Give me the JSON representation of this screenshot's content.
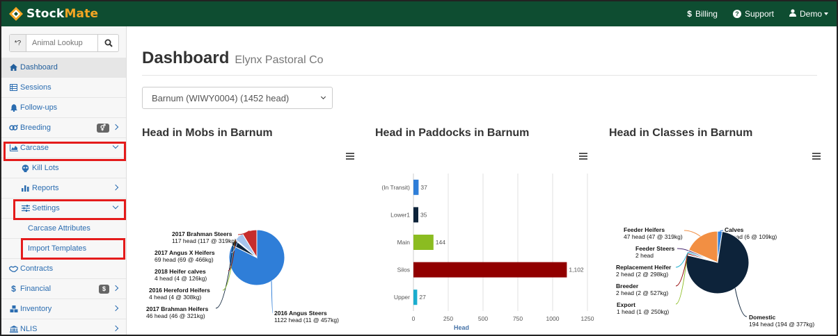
{
  "brand": {
    "name_a": "Stock",
    "name_b": "Mate"
  },
  "topnav": {
    "billing": "Billing",
    "billing_icon": "$",
    "support": "Support",
    "user": "Demo"
  },
  "search": {
    "prefix": "*?",
    "placeholder": "Animal Lookup"
  },
  "sidebar": {
    "items": [
      {
        "label": "Dashboard",
        "icon": "home-icon"
      },
      {
        "label": "Sessions",
        "icon": "table-icon"
      },
      {
        "label": "Follow-ups",
        "icon": "bell-icon"
      },
      {
        "label": "Breeding",
        "icon": "gender-icon"
      },
      {
        "label": "Carcase",
        "icon": "area-chart-icon"
      },
      {
        "label": "Kill Lots",
        "icon": "skull-icon"
      },
      {
        "label": "Reports",
        "icon": "bar-chart-icon"
      },
      {
        "label": "Settings",
        "icon": "sliders-icon"
      },
      {
        "label": "Carcase Attributes"
      },
      {
        "label": "Import Templates"
      },
      {
        "label": "Contracts",
        "icon": "handshake-icon"
      },
      {
        "label": "Financial",
        "icon": "dollar-icon",
        "badge": "$"
      },
      {
        "label": "Inventory",
        "icon": "cubes-icon"
      },
      {
        "label": "NLIS",
        "icon": "bank-icon"
      }
    ]
  },
  "page": {
    "title": "Dashboard",
    "subtitle": "Elynx Pastoral Co",
    "property_select": "Barnum (WIWY0004) (1452 head)"
  },
  "chart_data": [
    {
      "type": "pie",
      "title": "Head in Mobs in Barnum",
      "slices": [
        {
          "name": "2016 Angus Steers",
          "detail": "1122 head (11 @ 457kg)",
          "value": 1122,
          "color": "#2f7ed8"
        },
        {
          "name": "2017 Brahman Heifers",
          "detail": "46 head (46 @ 321kg)",
          "value": 46,
          "color": "#0d233a"
        },
        {
          "name": "2016 Hereford Heifers",
          "detail": "4 head (4 @ 308kg)",
          "value": 4,
          "color": "#8bbc21"
        },
        {
          "name": "2018 Heifer calves",
          "detail": "4 head (4 @ 126kg)",
          "value": 4,
          "color": "#910000"
        },
        {
          "name": "2017 Angus X Heifers",
          "detail": "69 head (69 @ 466kg)",
          "value": 69,
          "color": "#a6c5ee"
        },
        {
          "name": "2017 Brahman Steers",
          "detail": "117 head (117 @ 319kg)",
          "value": 117,
          "color": "#c62d2d"
        }
      ]
    },
    {
      "type": "bar",
      "title": "Head in Paddocks in Barnum",
      "categories": [
        "(In Transit)",
        "Lower1",
        "Main",
        "Silos",
        "Upper"
      ],
      "values": [
        37,
        35,
        144,
        1102,
        27
      ],
      "value_labels": [
        "37",
        "35",
        "144",
        "1,102",
        "27"
      ],
      "colors": [
        "#2f7ed8",
        "#0d233a",
        "#8bbc21",
        "#910000",
        "#1aadce"
      ],
      "xlabel": "Head",
      "xlim": [
        0,
        1250
      ],
      "ticks": [
        "0",
        "250",
        "500",
        "750",
        "1000",
        "1250"
      ]
    },
    {
      "type": "pie",
      "title": "Head in Classes in Barnum",
      "slices": [
        {
          "name": "Calves",
          "detail": "6 head (6 @ 109kg)",
          "value": 6,
          "color": "#2f7ed8"
        },
        {
          "name": "Domestic",
          "detail": "194 head (194 @ 377kg)",
          "value": 194,
          "color": "#0d233a"
        },
        {
          "name": "Export",
          "detail": "1 head (1 @ 250kg)",
          "value": 1,
          "color": "#8bbc21"
        },
        {
          "name": "Breeder",
          "detail": "2 head (2 @ 527kg)",
          "value": 2,
          "color": "#910000"
        },
        {
          "name": "Replacement Heifer",
          "detail": "2 head (2 @ 298kg)",
          "value": 2,
          "color": "#1aadce"
        },
        {
          "name": "Feeder Steers",
          "detail": "2 head",
          "value": 2,
          "color": "#492970"
        },
        {
          "name": "Feeder Heifers",
          "detail": "47 head (47 @ 319kg)",
          "value": 47,
          "color": "#f28f43"
        }
      ]
    }
  ]
}
